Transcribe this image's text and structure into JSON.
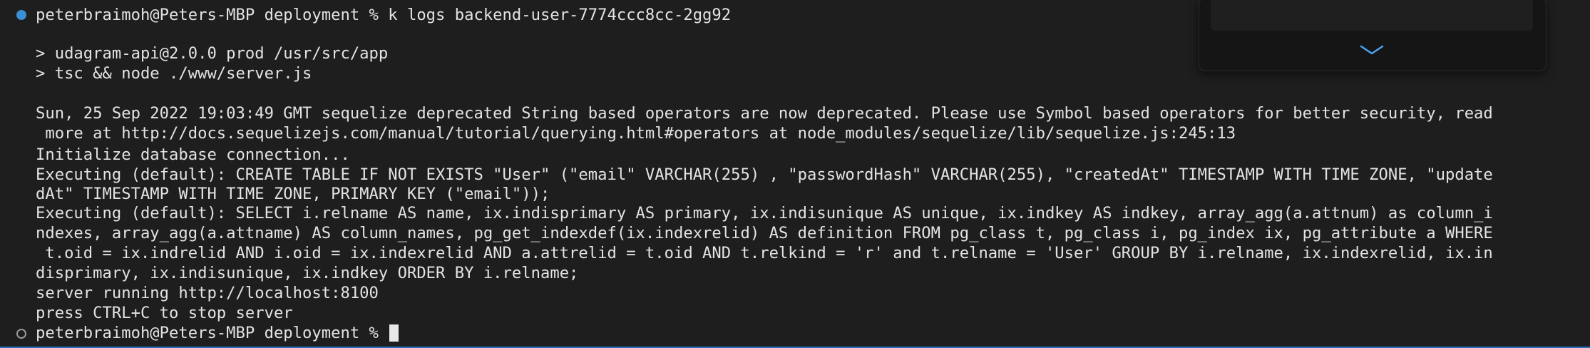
{
  "terminal": {
    "lines": [
      "peterbraimoh@Peters-MBP deployment % k logs backend-user-7774ccc8cc-2gg92",
      "",
      "> udagram-api@2.0.0 prod /usr/src/app",
      "> tsc && node ./www/server.js",
      "",
      "Sun, 25 Sep 2022 19:03:49 GMT sequelize deprecated String based operators are now deprecated. Please use Symbol based operators for better security, read",
      " more at http://docs.sequelizejs.com/manual/tutorial/querying.html#operators at node_modules/sequelize/lib/sequelize.js:245:13",
      "Initialize database connection...",
      "Executing (default): CREATE TABLE IF NOT EXISTS \"User\" (\"email\" VARCHAR(255) , \"passwordHash\" VARCHAR(255), \"createdAt\" TIMESTAMP WITH TIME ZONE, \"update",
      "dAt\" TIMESTAMP WITH TIME ZONE, PRIMARY KEY (\"email\"));",
      "Executing (default): SELECT i.relname AS name, ix.indisprimary AS primary, ix.indisunique AS unique, ix.indkey AS indkey, array_agg(a.attnum) as column_i",
      "ndexes, array_agg(a.attname) AS column_names, pg_get_indexdef(ix.indexrelid) AS definition FROM pg_class t, pg_class i, pg_index ix, pg_attribute a WHERE",
      " t.oid = ix.indrelid AND i.oid = ix.indexrelid AND a.attrelid = t.oid AND t.relkind = 'r' and t.relname = 'User' GROUP BY i.relname, ix.indexrelid, ix.in",
      "disprimary, ix.indisunique, ix.indkey ORDER BY i.relname;",
      "server running http://localhost:8100",
      "press CTRL+C to stop server",
      "peterbraimoh@Peters-MBP deployment % "
    ]
  },
  "colors": {
    "background": "#1e1e1e",
    "text": "#e3e3e3",
    "success_marker": "#3b8fd6",
    "idle_marker": "#9a9a9a"
  },
  "icons": {
    "command_status_success": "filled-circle-icon",
    "command_status_pending": "hollow-circle-icon",
    "scroll_down": "chevron-down-icon"
  }
}
